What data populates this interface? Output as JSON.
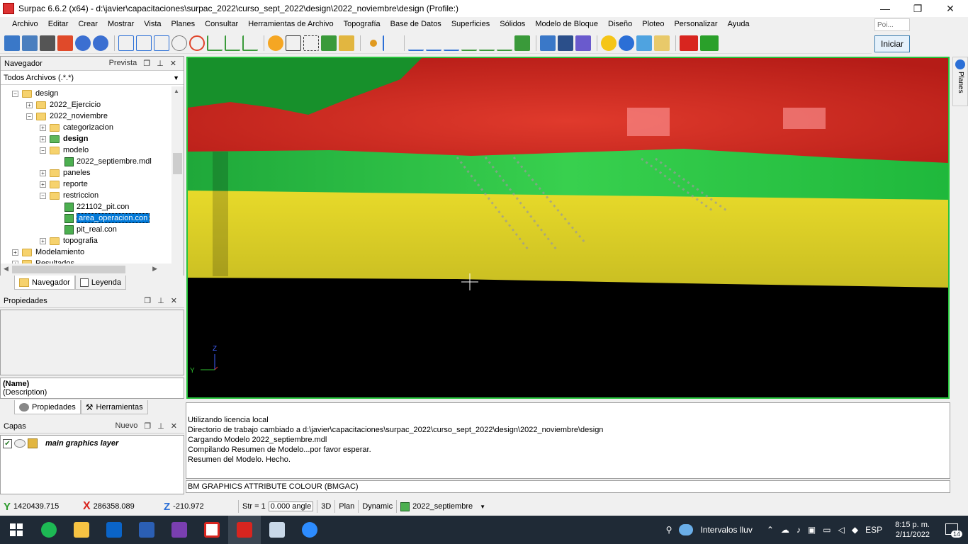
{
  "window": {
    "title": "Surpac 6.6.2 (x64) - d:\\javier\\capacitaciones\\surpac_2022\\curso_sept_2022\\design\\2022_noviembre\\design (Profile:)",
    "minimize": "—",
    "restore": "❐",
    "close": "✕"
  },
  "menu": [
    "Archivo",
    "Editar",
    "Crear",
    "Mostrar",
    "Vista",
    "Planes",
    "Consultar",
    "Herramientas de Archivo",
    "Topografía",
    "Base de Datos",
    "Superficies",
    "Sólidos",
    "Modelo de Bloque",
    "Diseño",
    "Ploteo",
    "Personalizar",
    "Ayuda"
  ],
  "search": {
    "placeholder": "Poi..."
  },
  "iniciar_label": "Iniciar",
  "navigator": {
    "title": "Navegador",
    "preview": "Prevista",
    "filter": "Todos Archivos (.*.*)",
    "tree": [
      {
        "label": "design",
        "level": 1,
        "type": "folder",
        "expander": "−"
      },
      {
        "label": "2022_Ejercicio",
        "level": 2,
        "type": "folder",
        "expander": "+"
      },
      {
        "label": "2022_noviembre",
        "level": 2,
        "type": "folder",
        "expander": "−"
      },
      {
        "label": "categorizacion",
        "level": 3,
        "type": "folder",
        "expander": "+"
      },
      {
        "label": "design",
        "level": 3,
        "type": "folder-green",
        "expander": "+",
        "bold": true
      },
      {
        "label": "modelo",
        "level": 3,
        "type": "folder",
        "expander": "−"
      },
      {
        "label": "2022_septiembre.mdl",
        "level": 4,
        "type": "file"
      },
      {
        "label": "paneles",
        "level": 3,
        "type": "folder",
        "expander": "+"
      },
      {
        "label": "reporte",
        "level": 3,
        "type": "folder",
        "expander": "+"
      },
      {
        "label": "restriccion",
        "level": 3,
        "type": "folder",
        "expander": "−"
      },
      {
        "label": "221102_pit.con",
        "level": 4,
        "type": "file"
      },
      {
        "label": "area_operacion.con",
        "level": 4,
        "type": "file",
        "selected": true
      },
      {
        "label": "pit_real.con",
        "level": 4,
        "type": "file"
      },
      {
        "label": "topografia",
        "level": 3,
        "type": "folder",
        "expander": "+"
      },
      {
        "label": "Modelamiento",
        "level": 1,
        "type": "folder",
        "expander": "+"
      },
      {
        "label": "Resultados",
        "level": 1,
        "type": "folder",
        "expander": "+"
      }
    ],
    "tabs": {
      "navegador": "Navegador",
      "leyenda": "Leyenda"
    }
  },
  "properties": {
    "title": "Propiedades",
    "name": "(Name)",
    "description": "(Description)",
    "tabs": {
      "propiedades": "Propiedades",
      "herramientas": "Herramientas"
    }
  },
  "layers": {
    "title": "Capas",
    "new_label": "Nuevo",
    "items": [
      {
        "label": "main graphics layer"
      }
    ]
  },
  "planes_tab": "Planes",
  "viewport": {
    "axes": {
      "z": "Z",
      "y": "Y"
    },
    "colors": {
      "black": "#000000",
      "yellow": "#e4d82c",
      "green": "#23c53c",
      "red": "#d8251f",
      "darkgreen": "#17902b"
    }
  },
  "console": {
    "lines": [
      "Utilizando licencia local",
      "Directorio de trabajo cambiado a d:\\javier\\capacitaciones\\surpac_2022\\curso_sept_2022\\design\\2022_noviembre\\design",
      "Cargando Modelo 2022_septiembre.mdl",
      "Compilando Resumen de Modelo...por favor esperar.",
      "Resumen del Modelo. Hecho."
    ],
    "attribute": "BM GRAPHICS ATTRIBUTE COLOUR (BMGAC)"
  },
  "status": {
    "y": "1420439.715",
    "x": "286358.089",
    "z": "-210.972",
    "str_label": "Str = 1",
    "angle": "0.000 angle",
    "mode3d": "3D",
    "plan": "Plan",
    "dynamic": "Dynamic",
    "model": "2022_septiembre"
  },
  "taskbar": {
    "weather": "Intervalos lluv",
    "lang": "ESP",
    "time": "8:15 p. m.",
    "date": "2/11/2022",
    "notifications": "14"
  }
}
